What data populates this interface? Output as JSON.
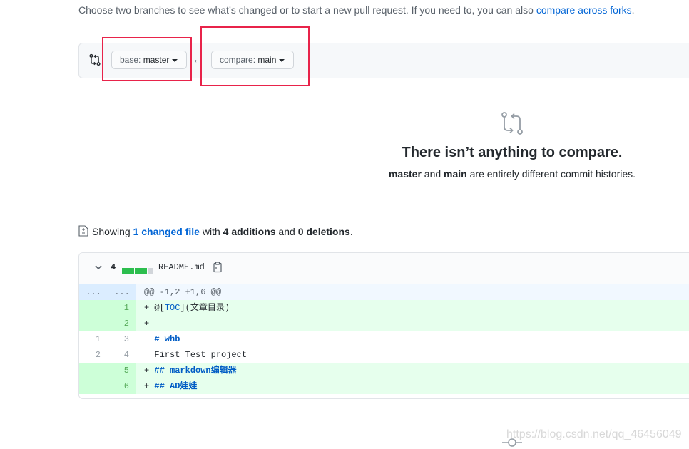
{
  "intro": {
    "text": "Choose two branches to see what’s changed or to start a new pull request. If you need to, you can also ",
    "link": "compare across forks",
    "end": "."
  },
  "range": {
    "base_key": "base:",
    "base_value": "master",
    "compare_key": "compare:",
    "compare_value": "main",
    "arrow": "←"
  },
  "blankslate": {
    "title": "There isn’t anything to compare.",
    "branch1": "master",
    "and": " and ",
    "branch2": "main",
    "rest": " are entirely different commit histories."
  },
  "summary": {
    "prefix": "Showing ",
    "files_link": "1 changed file",
    "with": " with ",
    "additions": "4 additions",
    "and": " and ",
    "deletions": "0 deletions",
    "end": "."
  },
  "file": {
    "changes": "4",
    "name": "README.md",
    "diffstat_colors": [
      "#2cbe4e",
      "#2cbe4e",
      "#2cbe4e",
      "#2cbe4e",
      "#d1d5da"
    ],
    "hunk": {
      "l": "...",
      "r": "...",
      "text": "@@ -1,2 +1,6 @@"
    },
    "lines": [
      {
        "type": "add",
        "old": "",
        "new": "1",
        "sign": "+ ",
        "pre": "@[",
        "tok": "TOC",
        "post": "](文章目录)",
        "style": "blue"
      },
      {
        "type": "add",
        "old": "",
        "new": "2",
        "sign": "+ ",
        "pre": "",
        "tok": "",
        "post": "",
        "style": ""
      },
      {
        "type": "ctx",
        "old": "1",
        "new": "3",
        "sign": "  ",
        "pre": "",
        "tok": "# whb",
        "post": "",
        "style": "bold"
      },
      {
        "type": "ctx",
        "old": "2",
        "new": "4",
        "sign": "  ",
        "pre": "First Test project",
        "tok": "",
        "post": "",
        "style": ""
      },
      {
        "type": "add",
        "old": "",
        "new": "5",
        "sign": "+ ",
        "pre": "",
        "tok": "## markdown编辑器",
        "post": "",
        "style": "bold"
      },
      {
        "type": "add",
        "old": "",
        "new": "6",
        "sign": "+ ",
        "pre": "",
        "tok": "## AD娃娃",
        "post": "",
        "style": "bold"
      }
    ]
  },
  "watermark": "https://blog.csdn.net/qq_46456049"
}
